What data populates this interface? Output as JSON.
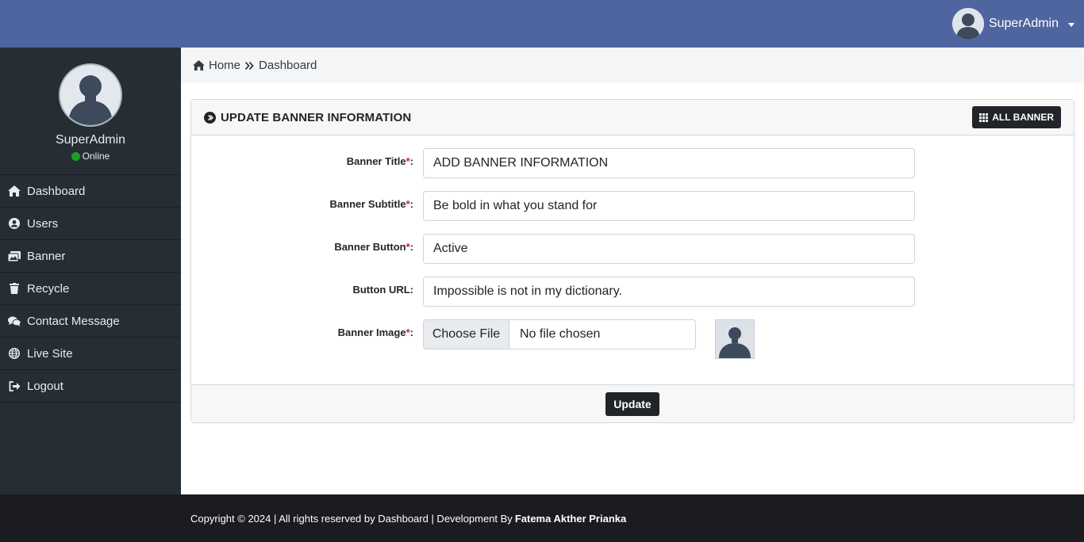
{
  "header": {
    "username": "SuperAdmin",
    "avatar_icon": "user-avatar-icon",
    "dropdown_icon": "caret-down-icon",
    "bg_color": "#4f65a0"
  },
  "sidebar": {
    "profile": {
      "name": "SuperAdmin",
      "status": "Online",
      "status_color": "#1d9d2a"
    },
    "items": [
      {
        "label": "Dashboard",
        "icon": "home-icon"
      },
      {
        "label": "Users",
        "icon": "user-circle-icon"
      },
      {
        "label": "Banner",
        "icon": "images-icon"
      },
      {
        "label": "Recycle",
        "icon": "trash-icon"
      },
      {
        "label": "Contact Message",
        "icon": "comments-icon"
      },
      {
        "label": "Live Site",
        "icon": "globe-icon"
      },
      {
        "label": "Logout",
        "icon": "sign-out-icon"
      }
    ],
    "bg_color": "#262d35"
  },
  "breadcrumb": {
    "home": "Home",
    "current": "Dashboard"
  },
  "card": {
    "title": "UPDATE BANNER INFORMATION",
    "all_button": "ALL BANNER",
    "fields": {
      "title": {
        "label": "Banner Title",
        "required": "*",
        "colon": ":",
        "value": "ADD BANNER INFORMATION"
      },
      "subtitle": {
        "label": "Banner Subtitle",
        "required": "*",
        "colon": ":",
        "value": "Be bold in what you stand for"
      },
      "button": {
        "label": "Banner Button",
        "required": "*",
        "colon": ":",
        "value": "Active"
      },
      "url": {
        "label": "Button URL:",
        "value": "Impossible is not in my dictionary."
      },
      "image": {
        "label": "Banner Image",
        "required": "*",
        "colon": ":",
        "choose": "Choose File",
        "chosen": "No file chosen"
      }
    },
    "update_button": "Update"
  },
  "footer": {
    "copyright": "Copyright © 2024 | All rights reserved by Dashboard | Development By",
    "developer": "Fatema Akther Prianka"
  }
}
